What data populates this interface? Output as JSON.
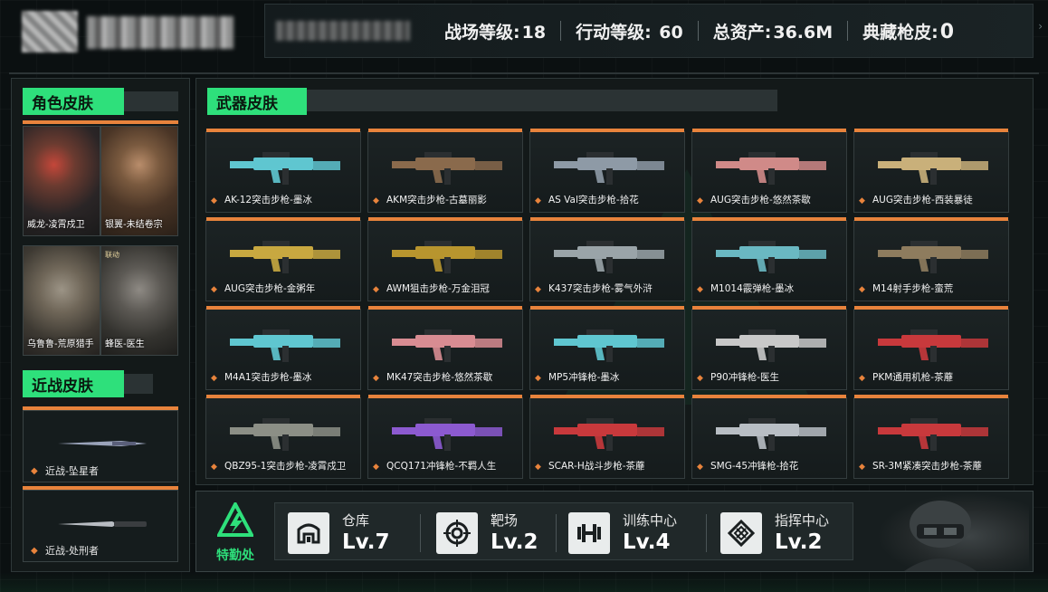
{
  "header": {
    "stats": [
      {
        "label": "战场等级:",
        "value": "18"
      },
      {
        "label": "行动等级:",
        "value": "60"
      },
      {
        "label": "总资产:",
        "value": "36.6M"
      },
      {
        "label": "典藏枪皮:",
        "value": "0"
      }
    ]
  },
  "character_section": {
    "title": "角色皮肤",
    "items": [
      {
        "name": "威龙-凌霄戍卫"
      },
      {
        "name": "银翼-未结卷宗"
      },
      {
        "name": "乌鲁鲁-荒原猎手"
      },
      {
        "name": "蜂医-医生",
        "tag": "联动"
      }
    ]
  },
  "melee_section": {
    "title": "近战皮肤",
    "items": [
      {
        "name": "近战-坠星者"
      },
      {
        "name": "近战-处刑者"
      }
    ]
  },
  "weapon_section": {
    "title": "武器皮肤",
    "items": [
      {
        "name": "AK-12突击步枪-墨冰",
        "color": "#5fc6d0"
      },
      {
        "name": "AKM突击步枪-古墓丽影",
        "color": "#8a6a4c"
      },
      {
        "name": "AS Val突击步枪-拾花",
        "color": "#8e9aa6"
      },
      {
        "name": "AUG突击步枪-悠然茶歇",
        "color": "#d08a88"
      },
      {
        "name": "AUG突击步枪-西装暴徒",
        "color": "#c9b07a"
      },
      {
        "name": "AUG突击步枪-金粥年",
        "color": "#c8a840"
      },
      {
        "name": "AWM狙击步枪-万金泪冠",
        "color": "#b8952e"
      },
      {
        "name": "K437突击步枪-雾气外浒",
        "color": "#9aa4a8"
      },
      {
        "name": "M1014霰弹枪-墨冰",
        "color": "#6ab8c2"
      },
      {
        "name": "M14射手步枪-蛮荒",
        "color": "#8e7c5e"
      },
      {
        "name": "M4A1突击步枪-墨冰",
        "color": "#5fc6d0"
      },
      {
        "name": "MK47突击步枪-悠然茶歇",
        "color": "#d88c92"
      },
      {
        "name": "MP5冲锋枪-墨冰",
        "color": "#5fc6d0"
      },
      {
        "name": "P90冲锋枪-医生",
        "color": "#c8c8c8"
      },
      {
        "name": "PKM通用机枪-茶蘼",
        "color": "#c8393c"
      },
      {
        "name": "QBZ95-1突击步枪-凌霄戍卫",
        "color": "#8c8f86"
      },
      {
        "name": "QCQ171冲锋枪-不羁人生",
        "color": "#8c5ad0"
      },
      {
        "name": "SCAR-H战斗步枪-茶蘼",
        "color": "#c8393c"
      },
      {
        "name": "SMG-45冲锋枪-拾花",
        "color": "#b8bec4"
      },
      {
        "name": "SR-3M紧凑突击步枪-茶蘼",
        "color": "#c8393c"
      }
    ]
  },
  "facility": {
    "title": "特勤处",
    "items": [
      {
        "name": "仓库",
        "level": "Lv.7",
        "icon": "warehouse-icon"
      },
      {
        "name": "靶场",
        "level": "Lv.2",
        "icon": "target-icon"
      },
      {
        "name": "训练中心",
        "level": "Lv.4",
        "icon": "dumbbell-icon"
      },
      {
        "name": "指挥中心",
        "level": "Lv.2",
        "icon": "command-icon"
      }
    ]
  }
}
